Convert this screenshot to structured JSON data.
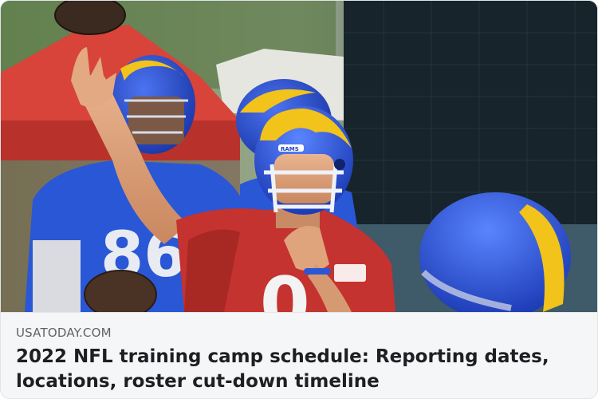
{
  "link_card": {
    "image": {
      "description_icon": "football-photo",
      "jersey_number_background_player": "86",
      "jersey_number_quarterback": "0",
      "helmet_text": "RAMS"
    },
    "domain": "USATODAY.COM",
    "title": "2022 NFL training camp schedule: Reporting dates, locations, roster cut-down timeline"
  },
  "colors": {
    "rams_blue": "#1d44c8",
    "rams_gold": "#f1c31b",
    "jersey_red": "#c4332f",
    "title_text": "#1d1f22",
    "domain_text": "#5f6368"
  }
}
